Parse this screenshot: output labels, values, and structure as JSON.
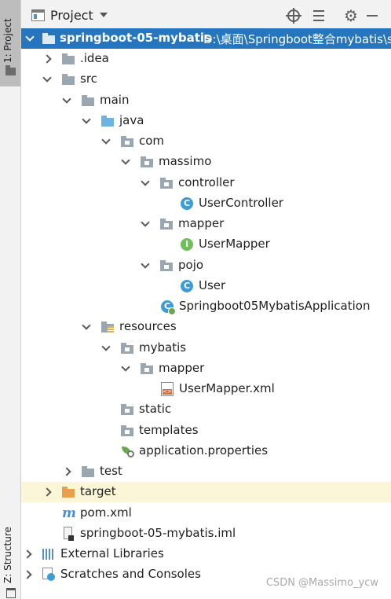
{
  "side_strip": {
    "project_tab": "1: Project",
    "structure_tab": "Z: Structure"
  },
  "header": {
    "title": "Project"
  },
  "tree": {
    "root": {
      "name": "springboot-05-mybatis",
      "path": "D:\\桌面\\Springboot整合mybatis\\s"
    },
    "items": [
      ".idea",
      "src",
      "main",
      "java",
      "com",
      "massimo",
      "controller",
      "UserController",
      "mapper",
      "UserMapper",
      "pojo",
      "User",
      "Springboot05MybatisApplication",
      "resources",
      "mybatis",
      "mapper",
      "UserMapper.xml",
      "static",
      "templates",
      "application.properties",
      "test",
      "target",
      "pom.xml",
      "springboot-05-mybatis.iml",
      "External Libraries",
      "Scratches and Consoles"
    ]
  },
  "icon_letters": {
    "class": "C",
    "interface": "I",
    "pom": "m"
  },
  "watermark": "CSDN @Massimo_ycw"
}
